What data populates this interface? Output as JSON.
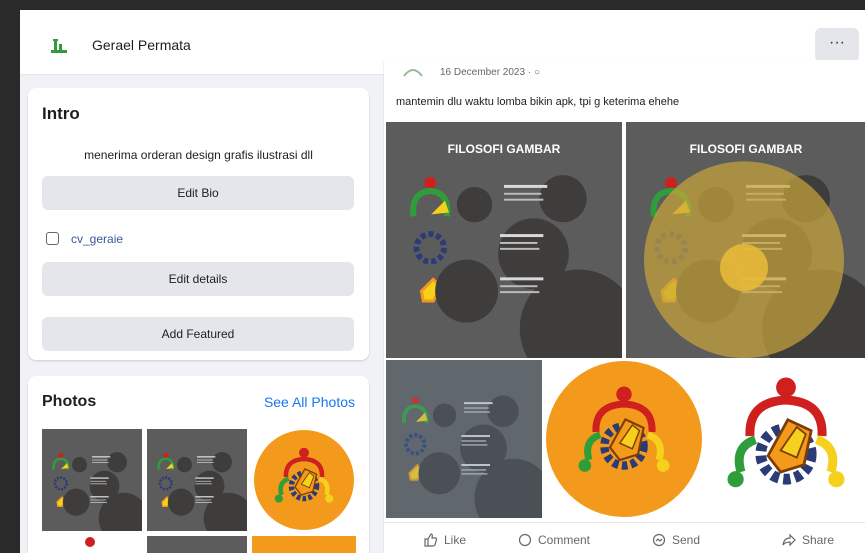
{
  "header": {
    "page_name": "Gerael Permata",
    "more_label": "···"
  },
  "intro": {
    "title": "Intro",
    "bio": "menerima orderan design grafis ilustrasi dll",
    "edit_bio": "Edit Bio",
    "instagram": "cv_geraie",
    "edit_details": "Edit details",
    "add_featured": "Add Featured"
  },
  "photos": {
    "title": "Photos",
    "see_all": "See All Photos"
  },
  "post": {
    "date": "16 December 2023 · ○",
    "caption": "mantemin dlu waktu lomba bikin apk, tpi g keterima ehehe",
    "poster_title": "FILOSOFI GAMBAR",
    "like": "Like",
    "comment": "Comment",
    "send": "Send",
    "share": "Share"
  },
  "colors": {
    "accent": "#1877f2",
    "orange": "#f39a1c",
    "red": "#cf1f1f",
    "green": "#2f9e3a",
    "yellow": "#f5d11e",
    "navy": "#2a3b78",
    "poster_bg": "#5d5c5c"
  }
}
